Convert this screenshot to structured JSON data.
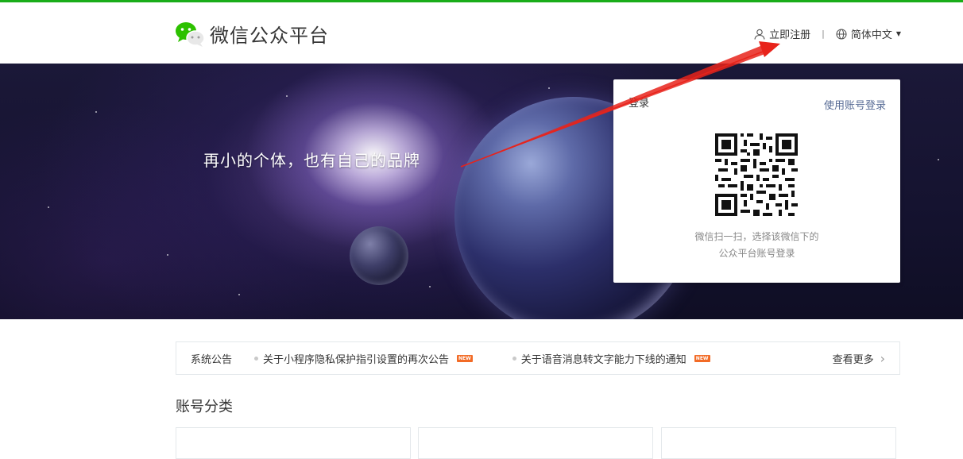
{
  "header": {
    "title": "微信公众平台",
    "register_label": "立即注册",
    "separator": "|",
    "language_label": "简体中文",
    "icons": {
      "logo": "wechat-logo-icon",
      "user": "user-icon",
      "globe": "globe-icon",
      "caret": "caret-down-icon"
    }
  },
  "banner": {
    "slogan": "再小的个体，也有自己的品牌"
  },
  "login": {
    "title": "登录",
    "switch_label": "使用账号登录",
    "tip_line1": "微信扫一扫，选择该微信下的",
    "tip_line2": "公众平台账号登录"
  },
  "notice": {
    "label": "系统公告",
    "items": [
      {
        "text": "关于小程序隐私保护指引设置的再次公告",
        "badge": "NEW"
      },
      {
        "text": "关于语音消息转文字能力下线的通知",
        "badge": "NEW"
      }
    ],
    "more_label": "查看更多"
  },
  "section": {
    "title": "账号分类"
  },
  "colors": {
    "brand_green": "#1aad19",
    "link_blue": "#576b95",
    "badge_orange": "#f26b26",
    "annotation_red": "#e8231b"
  }
}
